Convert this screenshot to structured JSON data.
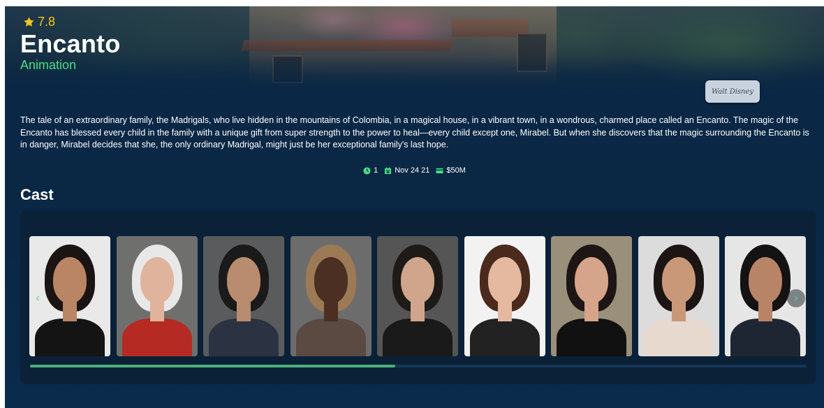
{
  "movie": {
    "rating": "7.8",
    "title": "Encanto",
    "genre": "Animation",
    "studio_logo_text": "Walt Disney",
    "overview": "The tale of an extraordinary family, the Madrigals, who live hidden in the mountains of Colombia, in a magical house, in a vibrant town, in a wondrous, charmed place called an Encanto. The magic of the Encanto has blessed every child in the family with a unique gift from super strength to the power to heal—every child except one, Mirabel. But when she discovers that the magic surrounding the Encanto is in danger, Mirabel decides that she, the only ordinary Madrigal, might just be her exceptional family's last hope."
  },
  "meta": {
    "runtime": "1",
    "release_date": "Nov 24 21",
    "budget": "$50M"
  },
  "cast": {
    "heading": "Cast",
    "prev_arrow": "‹",
    "next_arrow": "›",
    "scroll_progress": 0.47,
    "members": [
      {
        "portrait": "woman-dark-hair-smiling",
        "bg": "#e9e9ea",
        "skin": "#b98565",
        "hair": "#1a1412",
        "outfit": "#141414"
      },
      {
        "portrait": "older-woman-white-hair",
        "bg": "#6f6f6d",
        "skin": "#e0b39c",
        "hair": "#e8e8e8",
        "outfit": "#b62a24"
      },
      {
        "portrait": "man-dark-hair-suit",
        "bg": "#5a5b5d",
        "skin": "#b98c70",
        "hair": "#1b1a1a",
        "outfit": "#2b3342"
      },
      {
        "portrait": "man-flat-cap-smiling",
        "bg": "#6c6c6c",
        "skin": "#4a2f22",
        "hair": "#9c7a55",
        "outfit": "#5a4a42"
      },
      {
        "portrait": "woman-short-curly-hair",
        "bg": "#555555",
        "skin": "#d0a58c",
        "hair": "#1d1a18",
        "outfit": "#1a1a1a"
      },
      {
        "portrait": "woman-long-brown-hair",
        "bg": "#f2f2f2",
        "skin": "#e5b8a0",
        "hair": "#4a2a1c",
        "outfit": "#222222"
      },
      {
        "portrait": "woman-dark-hair-black-dress",
        "bg": "#9a8f7a",
        "skin": "#d5a48a",
        "hair": "#1d1615",
        "outfit": "#111111"
      },
      {
        "portrait": "woman-long-dark-hair",
        "bg": "#dcdcdc",
        "skin": "#c99878",
        "hair": "#1c1513",
        "outfit": "#e8d9cf"
      },
      {
        "portrait": "man-short-hair-dark-jacket",
        "bg": "#e6e6e6",
        "skin": "#b88468",
        "hair": "#141212",
        "outfit": "#1f2633"
      }
    ]
  },
  "colors": {
    "background": "#0a2744",
    "panel": "#0a2138",
    "accent_green": "#4ade80",
    "rating_gold": "#f5c518",
    "progress_fill": "#4caf7a"
  }
}
